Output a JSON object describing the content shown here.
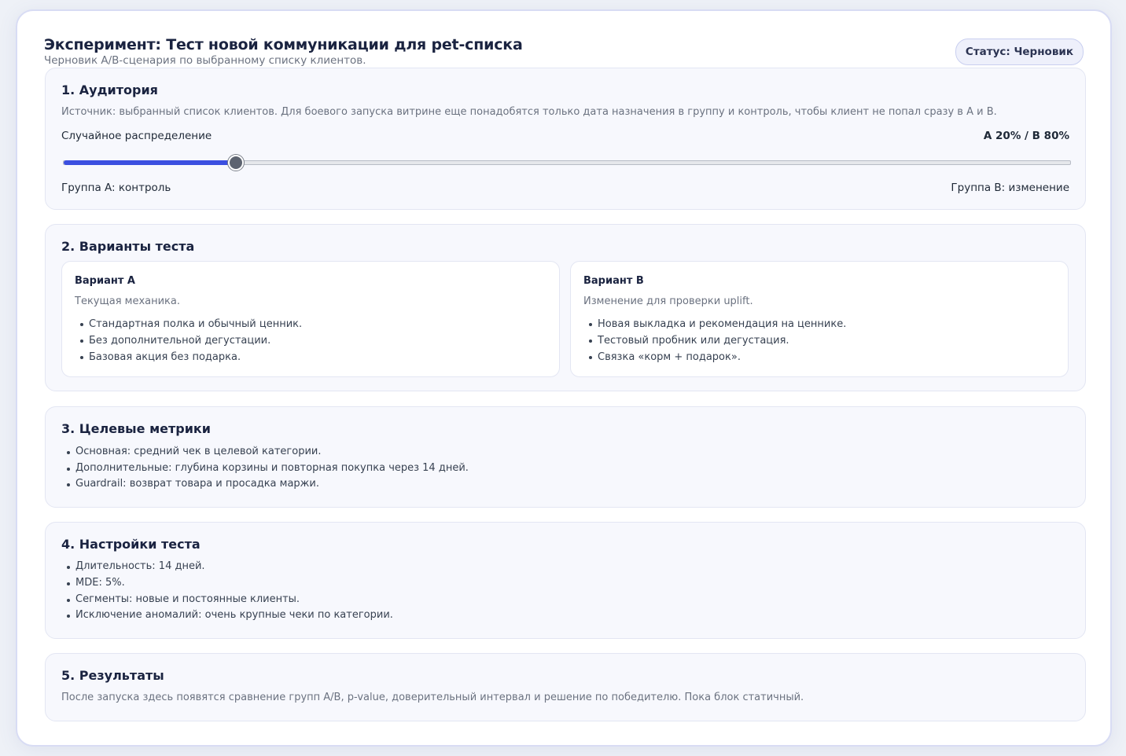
{
  "header": {
    "title": "Эксперимент: Тест новой коммуникации для pet-списка",
    "subtitle": "Черновик A/B-сценария по выбранному списку клиентов.",
    "status": "Статус: Черновик"
  },
  "audience": {
    "heading": "1. Аудитория",
    "description": "Источник: выбранный список клиентов. Для боевого запуска витрине еще понадобятся только дата назначения в группу и контроль, чтобы клиент не попал сразу в A и B.",
    "slider_label": "Случайное распределение",
    "split_value": "A 20% / B 80%",
    "group_a_share": 0.17,
    "group_a_label": "Группа A: контроль",
    "group_b_label": "Группа B: изменение"
  },
  "variants": {
    "heading": "2. Варианты теста",
    "a": {
      "title": "Вариант A",
      "description": "Текущая механика.",
      "items": [
        "Стандартная полка и обычный ценник.",
        "Без дополнительной дегустации.",
        "Базовая акция без подарка."
      ]
    },
    "b": {
      "title": "Вариант B",
      "description": "Изменение для проверки uplift.",
      "items": [
        "Новая выкладка и рекомендация на ценнике.",
        "Тестовый пробник или дегустация.",
        "Связка «корм + подарок»."
      ]
    }
  },
  "metrics": {
    "heading": "3. Целевые метрики",
    "items": [
      "Основная: средний чек в целевой категории.",
      "Дополнительные: глубина корзины и повторная покупка через 14 дней.",
      "Guardrail: возврат товара и просадка маржи."
    ]
  },
  "settings": {
    "heading": "4. Настройки теста",
    "items": [
      "Длительность: 14 дней.",
      "MDE: 5%.",
      "Сегменты: новые и постоянные клиенты.",
      "Исключение аномалий: очень крупные чеки по категории."
    ]
  },
  "results": {
    "heading": "5. Результаты",
    "description": "После запуска здесь появятся сравнение групп A/B, p-value, доверительный интервал и решение по победителю. Пока блок статичный."
  },
  "colors": {
    "accent": "#3b4fe0",
    "thumb": "#5d6370"
  }
}
